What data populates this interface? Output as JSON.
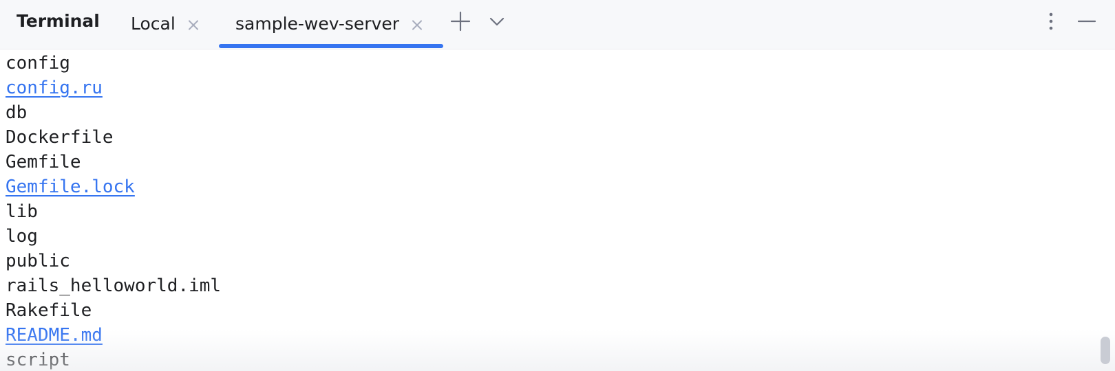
{
  "header": {
    "panel_title": "Terminal",
    "tabs": [
      {
        "label": "Local",
        "active": false
      },
      {
        "label": "sample-wev-server",
        "active": true
      }
    ],
    "icons": {
      "add": "plus-icon",
      "dropdown": "chevron-down-icon",
      "more": "more-vertical-icon",
      "minimize": "minimize-icon"
    },
    "accent_color": "#3574f0"
  },
  "terminal": {
    "lines": [
      {
        "text": "config",
        "link": false
      },
      {
        "text": "config.ru",
        "link": true
      },
      {
        "text": "db",
        "link": false
      },
      {
        "text": "Dockerfile",
        "link": false
      },
      {
        "text": "Gemfile",
        "link": false
      },
      {
        "text": "Gemfile.lock",
        "link": true
      },
      {
        "text": "lib",
        "link": false
      },
      {
        "text": "log",
        "link": false
      },
      {
        "text": "public",
        "link": false
      },
      {
        "text": "rails_helloworld.iml",
        "link": false
      },
      {
        "text": "Rakefile",
        "link": false
      },
      {
        "text": "README.md",
        "link": true
      },
      {
        "text": "script",
        "link": false
      }
    ],
    "link_color": "#3574f0",
    "text_color": "#1e1f22"
  }
}
